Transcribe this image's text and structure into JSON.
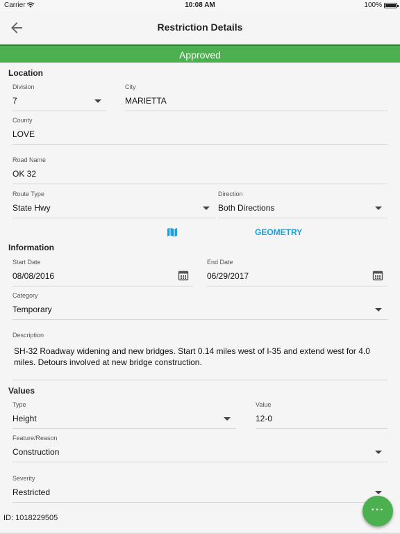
{
  "status_bar": {
    "carrier": "Carrier",
    "wifi_icon": "wifi-icon",
    "time": "10:08 AM",
    "battery": "100%"
  },
  "app_bar": {
    "back_icon": "arrow-left-icon",
    "title": "Restriction Details"
  },
  "status_banner": {
    "text": "Approved",
    "color": "#4caf50"
  },
  "location": {
    "title": "Location",
    "division": {
      "label": "Division",
      "value": "7"
    },
    "city": {
      "label": "City",
      "value": "MARIETTA"
    },
    "county": {
      "label": "County",
      "value": "LOVE"
    },
    "road_name": {
      "label": "Road Name",
      "value": "OK 32"
    },
    "route_type": {
      "label": "Route Type",
      "value": "State Hwy"
    },
    "direction": {
      "label": "Direction",
      "value": "Both Directions"
    },
    "geometry": {
      "icon": "map-icon",
      "label": "GEOMETRY",
      "color": "#1e9fd9"
    }
  },
  "information": {
    "title": "Information",
    "start_date": {
      "label": "Start Date",
      "value": "08/08/2016",
      "icon": "calendar-icon"
    },
    "end_date": {
      "label": "End Date",
      "value": "06/29/2017",
      "icon": "calendar-icon"
    },
    "category": {
      "label": "Category",
      "value": "Temporary"
    },
    "description": {
      "label": "Description",
      "value": "SH-32 Roadway widening and new bridges. Start 0.14 miles west of I-35 and extend west for 4.0 miles. Detours involved at new bridge construction."
    }
  },
  "values": {
    "title": "Values",
    "type": {
      "label": "Type",
      "value": "Height"
    },
    "value": {
      "label": "Value",
      "value": "12-0"
    },
    "feature_reason": {
      "label": "Feature/Reason",
      "value": "Construction"
    },
    "severity": {
      "label": "Severity",
      "value": "Restricted"
    }
  },
  "record": {
    "id_text": "ID: 1018229505"
  },
  "fab": {
    "icon": "more-icon",
    "label": "···",
    "color": "#4caf50"
  }
}
